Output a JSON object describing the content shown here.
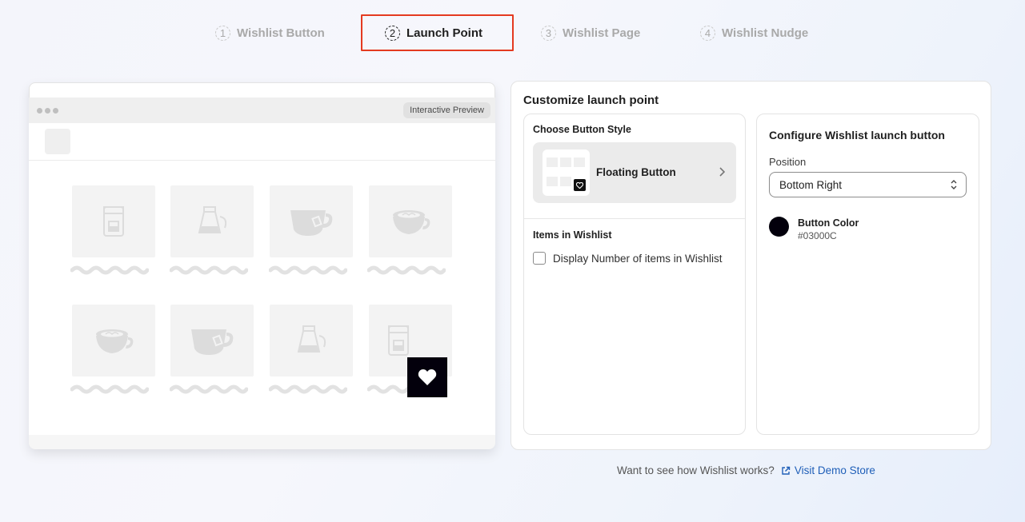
{
  "stepper": {
    "steps": [
      {
        "num": "1",
        "label": "Wishlist Button"
      },
      {
        "num": "2",
        "label": "Launch Point"
      },
      {
        "num": "3",
        "label": "Wishlist Page"
      },
      {
        "num": "4",
        "label": "Wishlist Nudge"
      }
    ],
    "active_index": 1,
    "highlight_color": "#e43a20"
  },
  "preview": {
    "badge": "Interactive Preview",
    "product_icons": [
      "coffee-machine-icon",
      "coffee-pot-icon",
      "tea-cup-icon",
      "latte-cup-icon",
      "latte-cup-icon",
      "tea-cup-icon",
      "coffee-pot-icon",
      "coffee-machine-icon"
    ],
    "floating_button_icon": "heart-icon"
  },
  "customize": {
    "title": "Customize launch point",
    "button_style": {
      "section_label": "Choose Button Style",
      "selected": "Floating Button",
      "chevron_icon": "chevron-right-icon"
    },
    "items_in_wishlist": {
      "section_label": "Items in Wishlist",
      "checkbox_label": "Display Number of items in Wishlist",
      "checked": false
    },
    "configure": {
      "title": "Configure Wishlist launch button",
      "position_label": "Position",
      "position_value": "Bottom Right",
      "color_label": "Button Color",
      "color_value": "#03000C"
    }
  },
  "footer": {
    "question": "Want to see how Wishlist works?",
    "link_label": "Visit Demo Store",
    "link_icon": "external-link-icon",
    "link_color": "#1f5fb8"
  }
}
